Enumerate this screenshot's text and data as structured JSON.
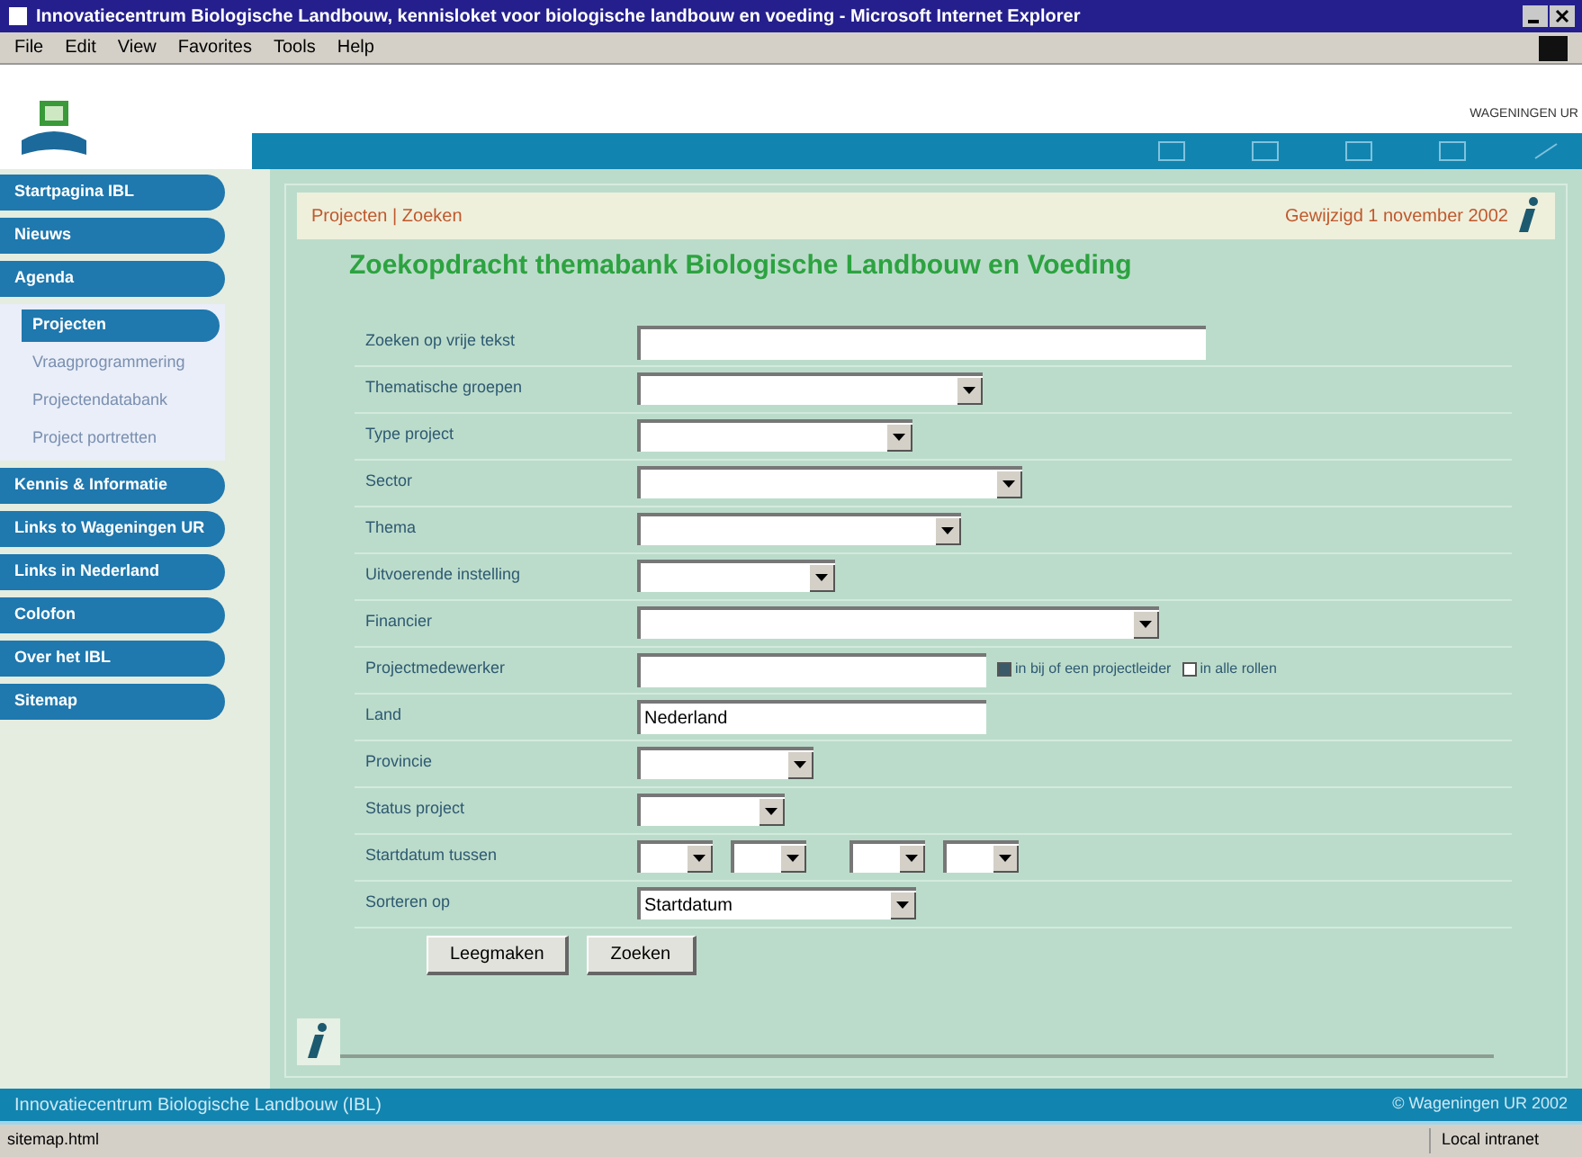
{
  "window": {
    "title": "Innovatiecentrum Biologische Landbouw, kennisloket voor biologische landbouw en voeding - Microsoft Internet Explorer"
  },
  "menu_bar": [
    "File",
    "Edit",
    "View",
    "Favorites",
    "Tools",
    "Help"
  ],
  "header": {
    "org_link": "WAGENINGEN UR"
  },
  "sidebar": {
    "items": [
      {
        "label": "Startpagina IBL",
        "selected": false
      },
      {
        "label": "Nieuws",
        "selected": false
      },
      {
        "label": "Agenda",
        "selected": false,
        "children": [
          {
            "label": "Projecten",
            "selected": true
          },
          {
            "label": "Vraagprogrammering",
            "selected": false
          },
          {
            "label": "Projectendatabank",
            "selected": false
          },
          {
            "label": "Project portretten",
            "selected": false
          }
        ]
      },
      {
        "label": "Kennis & Informatie",
        "selected": false
      },
      {
        "label": "Links to Wageningen UR",
        "selected": false
      },
      {
        "label": "Links in Nederland",
        "selected": false
      },
      {
        "label": "Colofon",
        "selected": false
      },
      {
        "label": "Over het IBL",
        "selected": false
      },
      {
        "label": "Sitemap",
        "selected": false
      }
    ]
  },
  "breadcrumb": "Projecten | Zoeken",
  "modified": "Gewijzigd 1 november 2002",
  "heading": "Zoekopdracht themabank Biologische Landbouw en Voeding",
  "fields": [
    {
      "label": "Zoeken op vrije tekst",
      "kind": "text"
    },
    {
      "label": "Thematische groepen",
      "kind": "select"
    },
    {
      "label": "Type project",
      "kind": "select"
    },
    {
      "label": "Sector",
      "kind": "select"
    },
    {
      "label": "Thema",
      "kind": "select"
    },
    {
      "label": "Uitvoerende instelling",
      "kind": "select"
    },
    {
      "label": "Financier",
      "kind": "select"
    },
    {
      "label": "Projectmedewerker",
      "kind": "text",
      "options": [
        {
          "label": "in bij of een projectleider",
          "selected": true
        },
        {
          "label": "in alle rollen",
          "selected": false
        }
      ]
    },
    {
      "label": "Land",
      "kind": "text",
      "value": "Nederland"
    },
    {
      "label": "Provincie",
      "kind": "select"
    },
    {
      "label": "Status project",
      "kind": "select"
    },
    {
      "label": "Startdatum tussen",
      "kind": "date_range"
    },
    {
      "label": "Sorteren op",
      "kind": "select",
      "value": "Startdatum"
    }
  ],
  "buttons": [
    "Leegmaken",
    "Zoeken"
  ],
  "footer": {
    "left": "Innovatiecentrum Biologische Landbouw (IBL)",
    "right": "© Wageningen UR 2002"
  },
  "status_bar": {
    "text": "sitemap.html",
    "zone": "Local intranet"
  }
}
